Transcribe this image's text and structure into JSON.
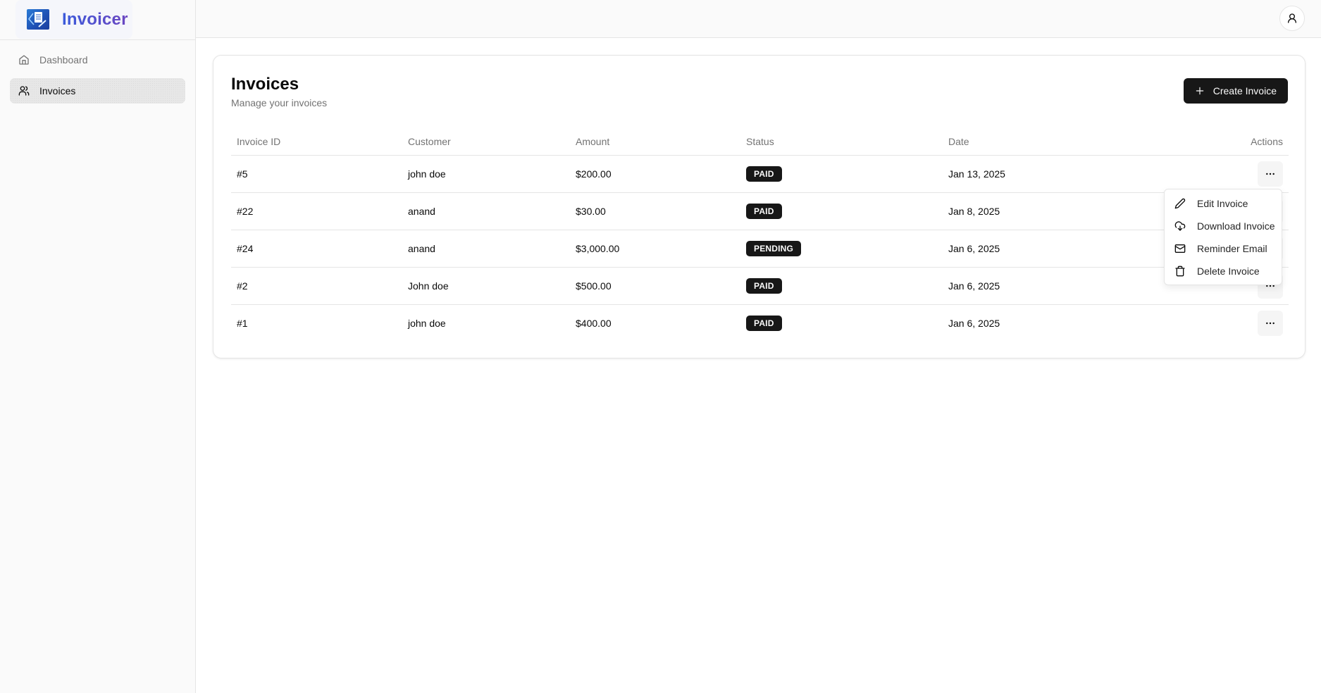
{
  "app": {
    "name": "Invoicer",
    "brand_gradient": [
      "#3b5bdb",
      "#6b46c1"
    ]
  },
  "sidebar": {
    "items": [
      {
        "label": "Dashboard",
        "icon": "home-icon",
        "active": false
      },
      {
        "label": "Invoices",
        "icon": "users-icon",
        "active": true
      }
    ]
  },
  "header": {
    "user_icon": "user-icon"
  },
  "page": {
    "title": "Invoices",
    "subtitle": "Manage your invoices",
    "create_button_label": "Create Invoice"
  },
  "table": {
    "columns": [
      "Invoice ID",
      "Customer",
      "Amount",
      "Status",
      "Date",
      "Actions"
    ],
    "rows": [
      {
        "id": "#5",
        "customer": "john doe",
        "amount": "$200.00",
        "status": "PAID",
        "date": "Jan 13, 2025"
      },
      {
        "id": "#22",
        "customer": "anand",
        "amount": "$30.00",
        "status": "PAID",
        "date": "Jan 8, 2025"
      },
      {
        "id": "#24",
        "customer": "anand",
        "amount": "$3,000.00",
        "status": "PENDING",
        "date": "Jan 6, 2025"
      },
      {
        "id": "#2",
        "customer": "John doe",
        "amount": "$500.00",
        "status": "PAID",
        "date": "Jan 6, 2025"
      },
      {
        "id": "#1",
        "customer": "john doe",
        "amount": "$400.00",
        "status": "PAID",
        "date": "Jan 6, 2025"
      }
    ]
  },
  "actions_menu": {
    "open_for_row": "#5",
    "items": [
      {
        "label": "Edit Invoice",
        "icon": "pencil-icon"
      },
      {
        "label": "Download Invoice",
        "icon": "cloud-download-icon"
      },
      {
        "label": "Reminder Email",
        "icon": "mail-icon"
      },
      {
        "label": "Delete Invoice",
        "icon": "trash-icon"
      }
    ]
  },
  "colors": {
    "primary_button": "#171717",
    "badge_bg": "#171717",
    "muted_text": "#737373",
    "border": "#e5e5e5"
  }
}
